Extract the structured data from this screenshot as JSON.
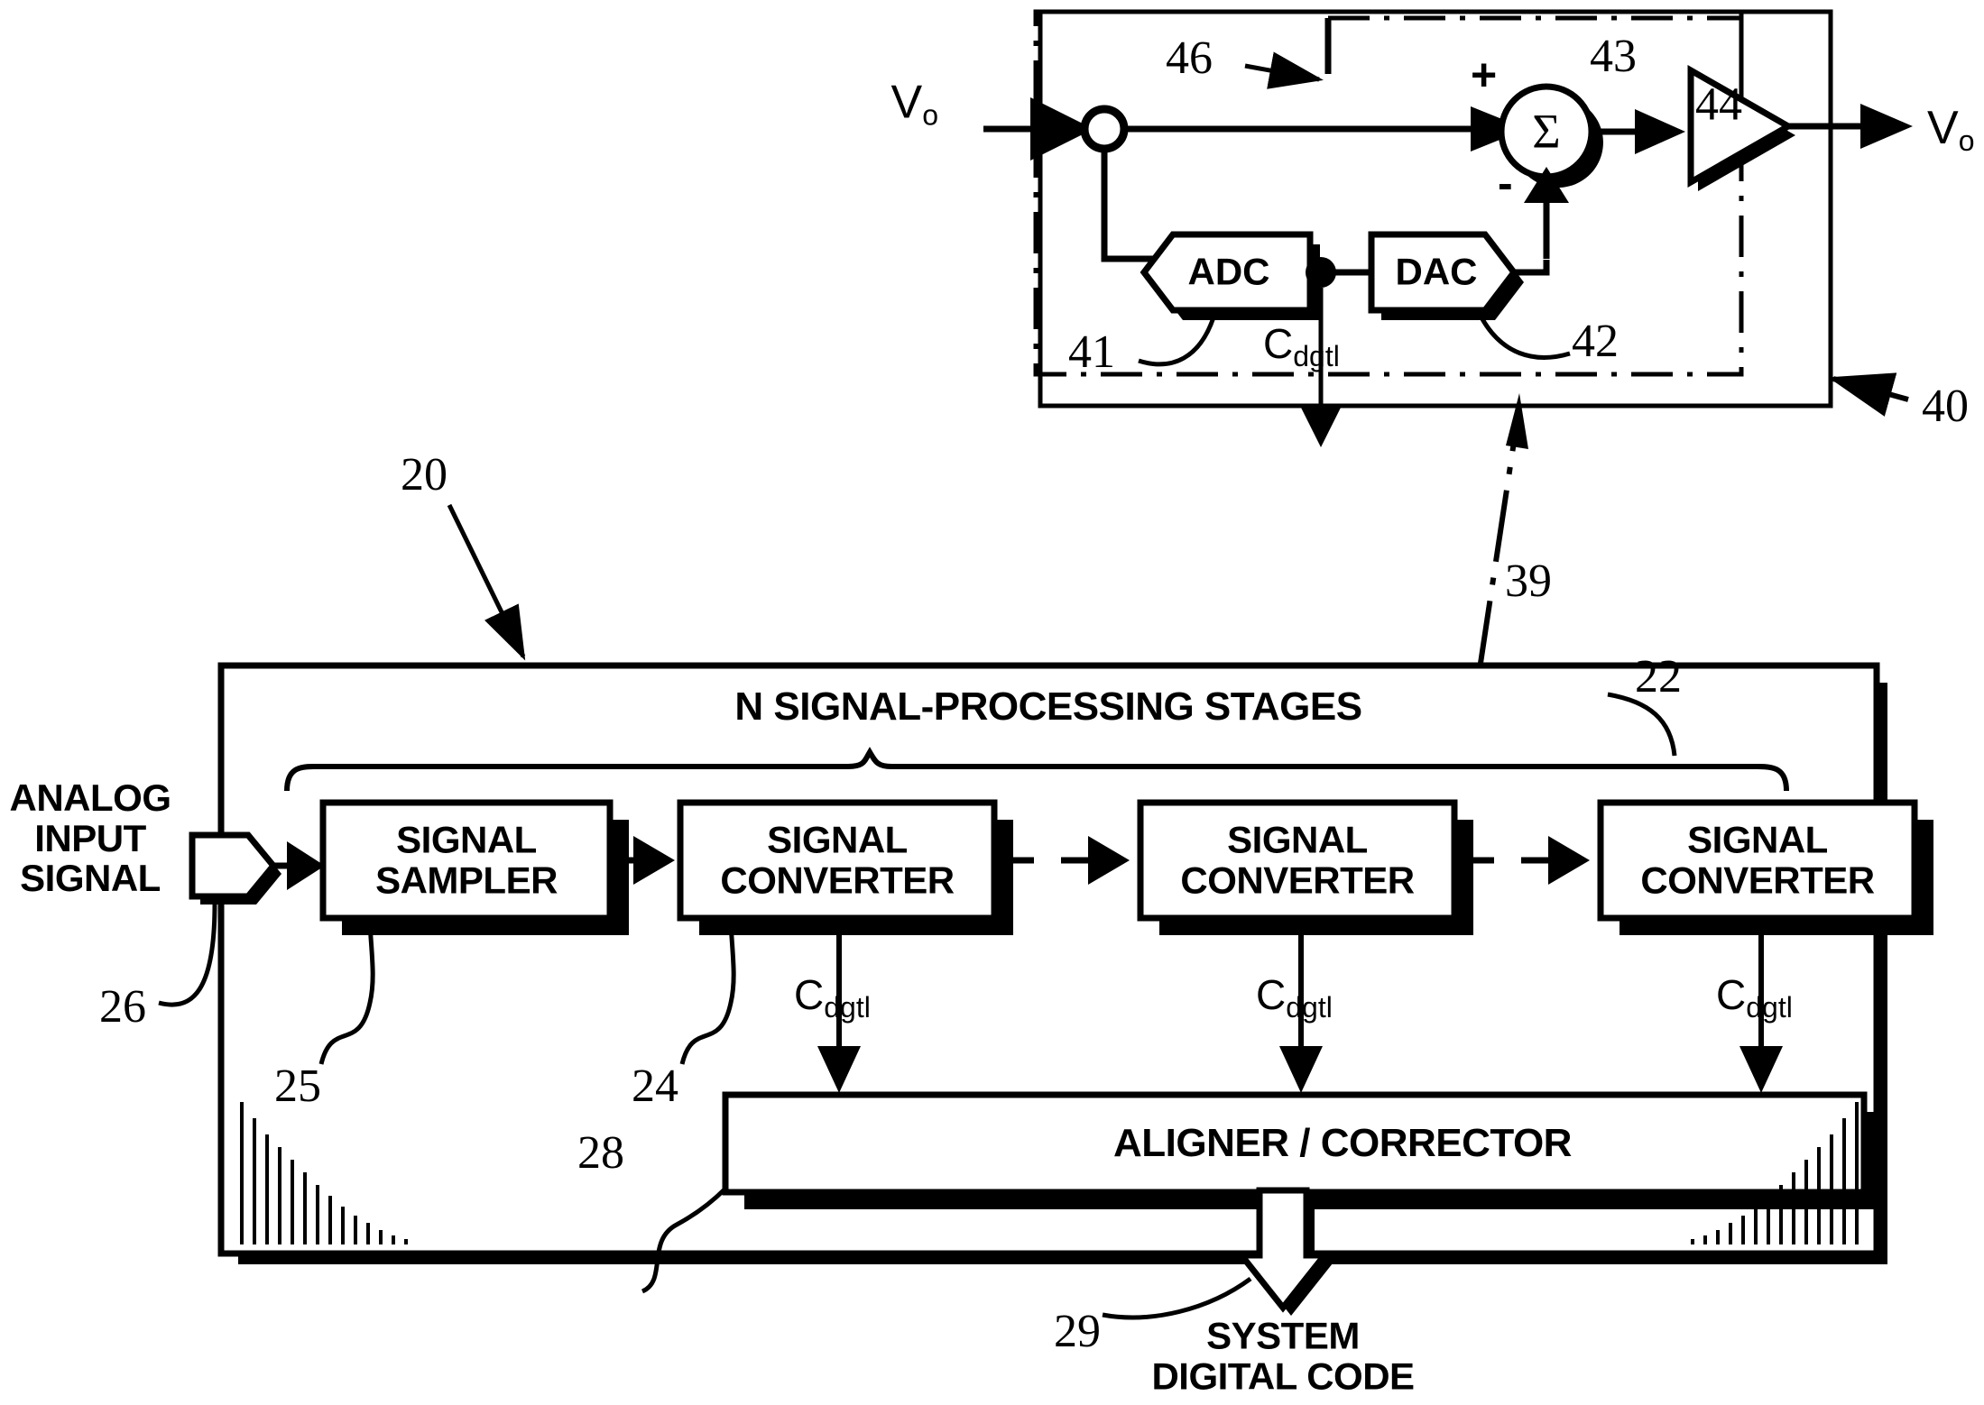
{
  "figure": {
    "title": "Pipelined analog-to-digital converter block diagram",
    "ink_color": "#000000",
    "background_color": "#ffffff"
  },
  "top_circuit": {
    "reference": "40",
    "detail_reference": "39",
    "input_label": "V",
    "input_sub": "o",
    "output_label": "V",
    "output_sub": "o",
    "feedforward_reference": "46",
    "summer_reference": "43",
    "summer_symbol": "Σ",
    "summer_plus": "+",
    "summer_minus": "-",
    "amplifier_reference": "44",
    "adc": {
      "label": "ADC",
      "reference": "41"
    },
    "dac": {
      "label": "DAC",
      "reference": "42"
    },
    "digital_code": {
      "base": "C",
      "sub": "dgtl"
    }
  },
  "system": {
    "reference": "20",
    "stages_reference": "22",
    "stages_heading": "N SIGNAL-PROCESSING STAGES",
    "input_label_lines": [
      "ANALOG",
      "INPUT",
      "SIGNAL"
    ],
    "input_reference": "26",
    "sampler": {
      "lines": [
        "SIGNAL",
        "SAMPLER"
      ],
      "reference": "25"
    },
    "converters": [
      {
        "lines": [
          "SIGNAL",
          "CONVERTER"
        ],
        "reference": "24",
        "code_base": "C",
        "code_sub": "dgtl"
      },
      {
        "lines": [
          "SIGNAL",
          "CONVERTER"
        ],
        "reference": "",
        "code_base": "C",
        "code_sub": "dgtl"
      },
      {
        "lines": [
          "SIGNAL",
          "CONVERTER"
        ],
        "reference": "",
        "code_base": "C",
        "code_sub": "dgtl"
      }
    ],
    "aligner": {
      "label": "ALIGNER / CORRECTOR",
      "reference": "28"
    },
    "output": {
      "lines": [
        "SYSTEM",
        "DIGITAL CODE"
      ],
      "reference": "29"
    }
  }
}
